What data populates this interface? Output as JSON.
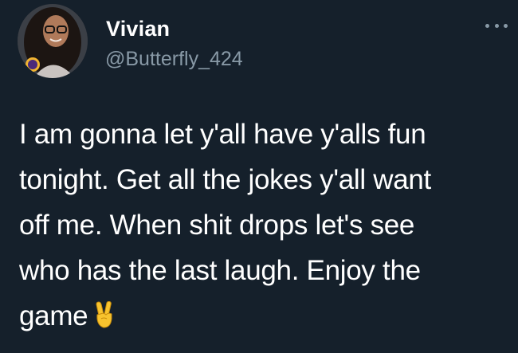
{
  "author": {
    "display_name": "Vivian",
    "handle": "@Butterfly_424",
    "avatar_icon": "profile-photo"
  },
  "more_icon": "more-horizontal-icon",
  "tweet": {
    "lines": [
      "I am gonna let y'all have y'alls fun",
      "tonight. Get all the jokes y'all want",
      "off me. When shit drops let's see",
      "who has the last laugh. Enjoy the",
      "game"
    ],
    "emoji": "victory-hand-icon"
  },
  "colors": {
    "background": "#15202b",
    "primary_text": "#ffffff",
    "secondary_text": "#8899a6"
  }
}
